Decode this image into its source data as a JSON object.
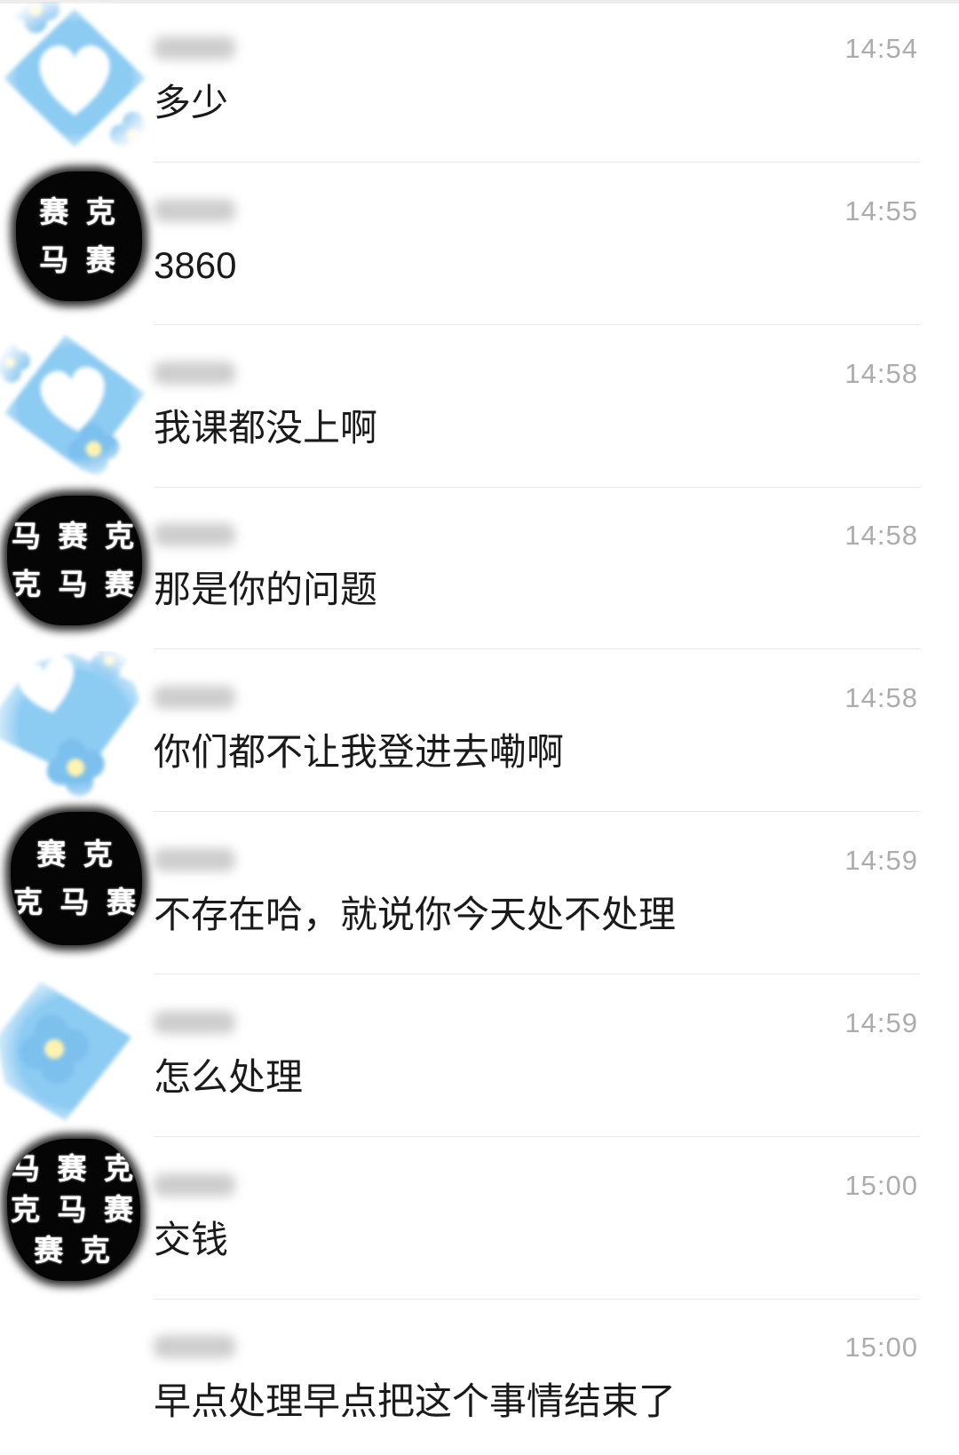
{
  "messages": [
    {
      "time": "14:54",
      "text": "多少",
      "avatar": "blue-heart-flower-avatar"
    },
    {
      "time": "14:55",
      "text": "3860",
      "avatar": "mosaic-avatar",
      "avatar_text": [
        "赛 克",
        "马 赛"
      ]
    },
    {
      "time": "14:58",
      "text": "我课都没上啊",
      "avatar": "blue-heart-flower-avatar"
    },
    {
      "time": "14:58",
      "text": "那是你的问题",
      "avatar": "mosaic-avatar",
      "avatar_text": [
        "马 赛 克",
        "克 马 赛"
      ]
    },
    {
      "time": "14:58",
      "text": "你们都不让我登进去嘞啊",
      "avatar": "blue-heart-flower-avatar"
    },
    {
      "time": "14:59",
      "text": "不存在哈，就说你今天处不处理",
      "avatar": "mosaic-avatar",
      "avatar_text": [
        "赛 克",
        "克 马 赛"
      ]
    },
    {
      "time": "14:59",
      "text": "怎么处理",
      "avatar": "blue-heart-flower-avatar"
    },
    {
      "time": "15:00",
      "text": "交钱",
      "avatar": "mosaic-avatar",
      "avatar_text": [
        "马 赛 克",
        "克 马 赛",
        "赛 克"
      ]
    },
    {
      "time": "15:00",
      "text": "早点处理早点把这个事情结束了",
      "avatar": ""
    }
  ],
  "colors": {
    "background": "#ffffff",
    "message_text": "#1a1a1a",
    "time_text": "#acacac",
    "divider": "#e8e8e8",
    "avatar_blue": "#8ccbf2",
    "avatar_black": "#050505"
  }
}
